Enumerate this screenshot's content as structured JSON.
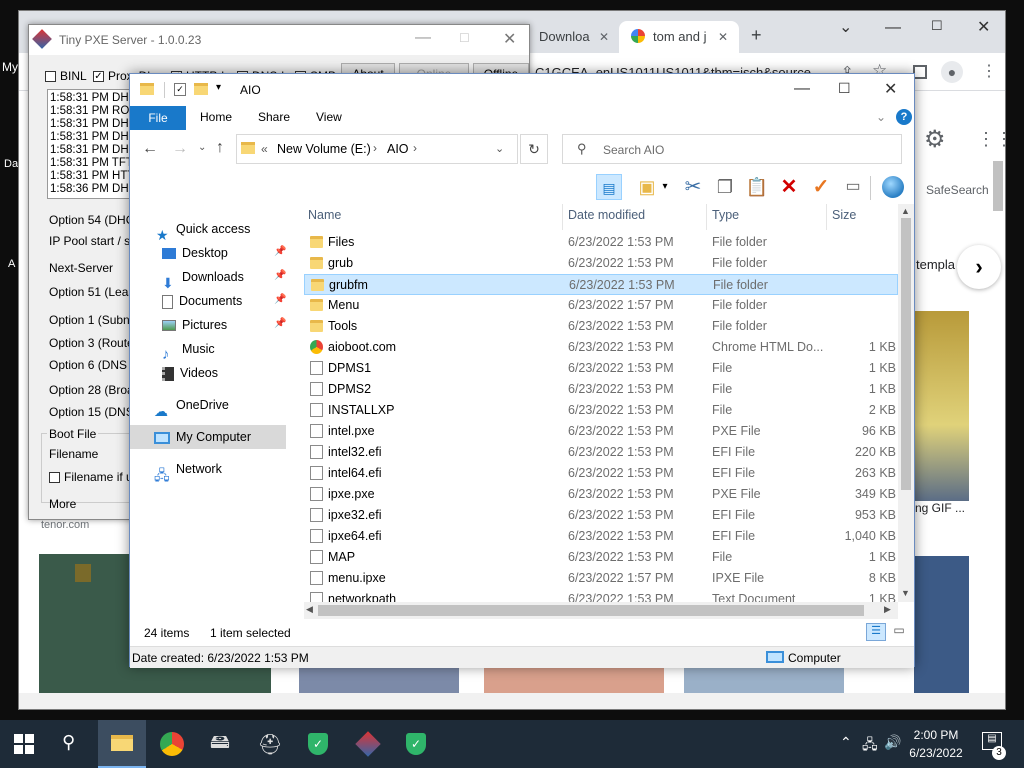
{
  "desktop": {
    "label_my": "My",
    "label_da": "Da",
    "label_a": "A"
  },
  "chrome": {
    "tabs": [
      {
        "label": "Downloa"
      },
      {
        "label": "tom and j"
      }
    ],
    "new_tab": "+",
    "url": "C1GCEA_enUS1011US1011&tbm=isch&source",
    "safesearch": "SafeSearch",
    "template_text": "templa",
    "gif_text": "ng GIF ...",
    "tenor": "tenor.com"
  },
  "pxe": {
    "title": "Tiny PXE Server - 1.0.0.23",
    "checks": {
      "binl": "BINL",
      "proxydhcp": "ProxyDhcp",
      "httpd": "HTTPd",
      "dnsd": "DNSd",
      "smb": "SMB"
    },
    "buttons": {
      "about": "About",
      "online": "Online",
      "offline": "Offline",
      "more": "More"
    },
    "log": [
      "1:58:31 PM DHCP",
      "1:58:31 PM ROOT",
      "1:58:31 PM DHCP",
      "1:58:31 PM DHCP",
      "1:58:31 PM DHCP",
      "1:58:31 PM TFTP",
      "1:58:31 PM HTT",
      "1:58:36 PM DHC"
    ],
    "options": {
      "opt54": "Option 54 (DHCF",
      "ippool": "IP Pool start / siz",
      "nextserver": "Next-Server",
      "opt51": "Option 51 (Lease",
      "opt1": "Option 1  (Subne",
      "opt3": "Option 3  (Router",
      "opt6": "Option 6  (DNS S",
      "opt28": "Option 28 (Broad",
      "opt15": "Option 15 (DNS I"
    },
    "bootfile_group": "Boot File",
    "filename": "Filename",
    "filename_if": "Filename if us"
  },
  "explorer": {
    "title": "AIO",
    "ribbon_tabs": {
      "file": "File",
      "home": "Home",
      "share": "Share",
      "view": "View"
    },
    "address": {
      "prefix": "«",
      "drive": "New Volume (E:)",
      "sep": "›",
      "folder": "AIO"
    },
    "search_placeholder": "Search AIO",
    "nav": {
      "quick_access": "Quick access",
      "desktop": "Desktop",
      "downloads": "Downloads",
      "documents": "Documents",
      "pictures": "Pictures",
      "music": "Music",
      "videos": "Videos",
      "onedrive": "OneDrive",
      "mycomputer": "My Computer",
      "network": "Network"
    },
    "columns": {
      "name": "Name",
      "date": "Date modified",
      "type": "Type",
      "size": "Size"
    },
    "files": [
      {
        "name": "Files",
        "date": "6/23/2022 1:53 PM",
        "type": "File folder",
        "size": "",
        "icon": "folder"
      },
      {
        "name": "grub",
        "date": "6/23/2022 1:53 PM",
        "type": "File folder",
        "size": "",
        "icon": "folder"
      },
      {
        "name": "grubfm",
        "date": "6/23/2022 1:53 PM",
        "type": "File folder",
        "size": "",
        "icon": "folder"
      },
      {
        "name": "Menu",
        "date": "6/23/2022 1:57 PM",
        "type": "File folder",
        "size": "",
        "icon": "folder"
      },
      {
        "name": "Tools",
        "date": "6/23/2022 1:53 PM",
        "type": "File folder",
        "size": "",
        "icon": "folder"
      },
      {
        "name": "aioboot.com",
        "date": "6/23/2022 1:53 PM",
        "type": "Chrome HTML Do...",
        "size": "1 KB",
        "icon": "chrome"
      },
      {
        "name": "DPMS1",
        "date": "6/23/2022 1:53 PM",
        "type": "File",
        "size": "1 KB",
        "icon": "doc"
      },
      {
        "name": "DPMS2",
        "date": "6/23/2022 1:53 PM",
        "type": "File",
        "size": "1 KB",
        "icon": "doc"
      },
      {
        "name": "INSTALLXP",
        "date": "6/23/2022 1:53 PM",
        "type": "File",
        "size": "2 KB",
        "icon": "doc"
      },
      {
        "name": "intel.pxe",
        "date": "6/23/2022 1:53 PM",
        "type": "PXE File",
        "size": "96 KB",
        "icon": "doc"
      },
      {
        "name": "intel32.efi",
        "date": "6/23/2022 1:53 PM",
        "type": "EFI File",
        "size": "220 KB",
        "icon": "doc"
      },
      {
        "name": "intel64.efi",
        "date": "6/23/2022 1:53 PM",
        "type": "EFI File",
        "size": "263 KB",
        "icon": "doc"
      },
      {
        "name": "ipxe.pxe",
        "date": "6/23/2022 1:53 PM",
        "type": "PXE File",
        "size": "349 KB",
        "icon": "doc"
      },
      {
        "name": "ipxe32.efi",
        "date": "6/23/2022 1:53 PM",
        "type": "EFI File",
        "size": "953 KB",
        "icon": "doc"
      },
      {
        "name": "ipxe64.efi",
        "date": "6/23/2022 1:53 PM",
        "type": "EFI File",
        "size": "1,040 KB",
        "icon": "doc"
      },
      {
        "name": "MAP",
        "date": "6/23/2022 1:53 PM",
        "type": "File",
        "size": "1 KB",
        "icon": "doc"
      },
      {
        "name": "menu.ipxe",
        "date": "6/23/2022 1:57 PM",
        "type": "IPXE File",
        "size": "8 KB",
        "icon": "doc"
      },
      {
        "name": "networkpath",
        "date": "6/23/2022 1:53 PM",
        "type": "Text Document",
        "size": "1 KB",
        "icon": "doc"
      }
    ],
    "selected_index": 2,
    "status": {
      "items": "24 items",
      "selected": "1 item selected"
    },
    "details": {
      "created": "Date created: 6/23/2022 1:53 PM",
      "location": "Computer"
    }
  },
  "taskbar": {
    "time": "2:00 PM",
    "date": "6/23/2022",
    "notifications": "3"
  }
}
